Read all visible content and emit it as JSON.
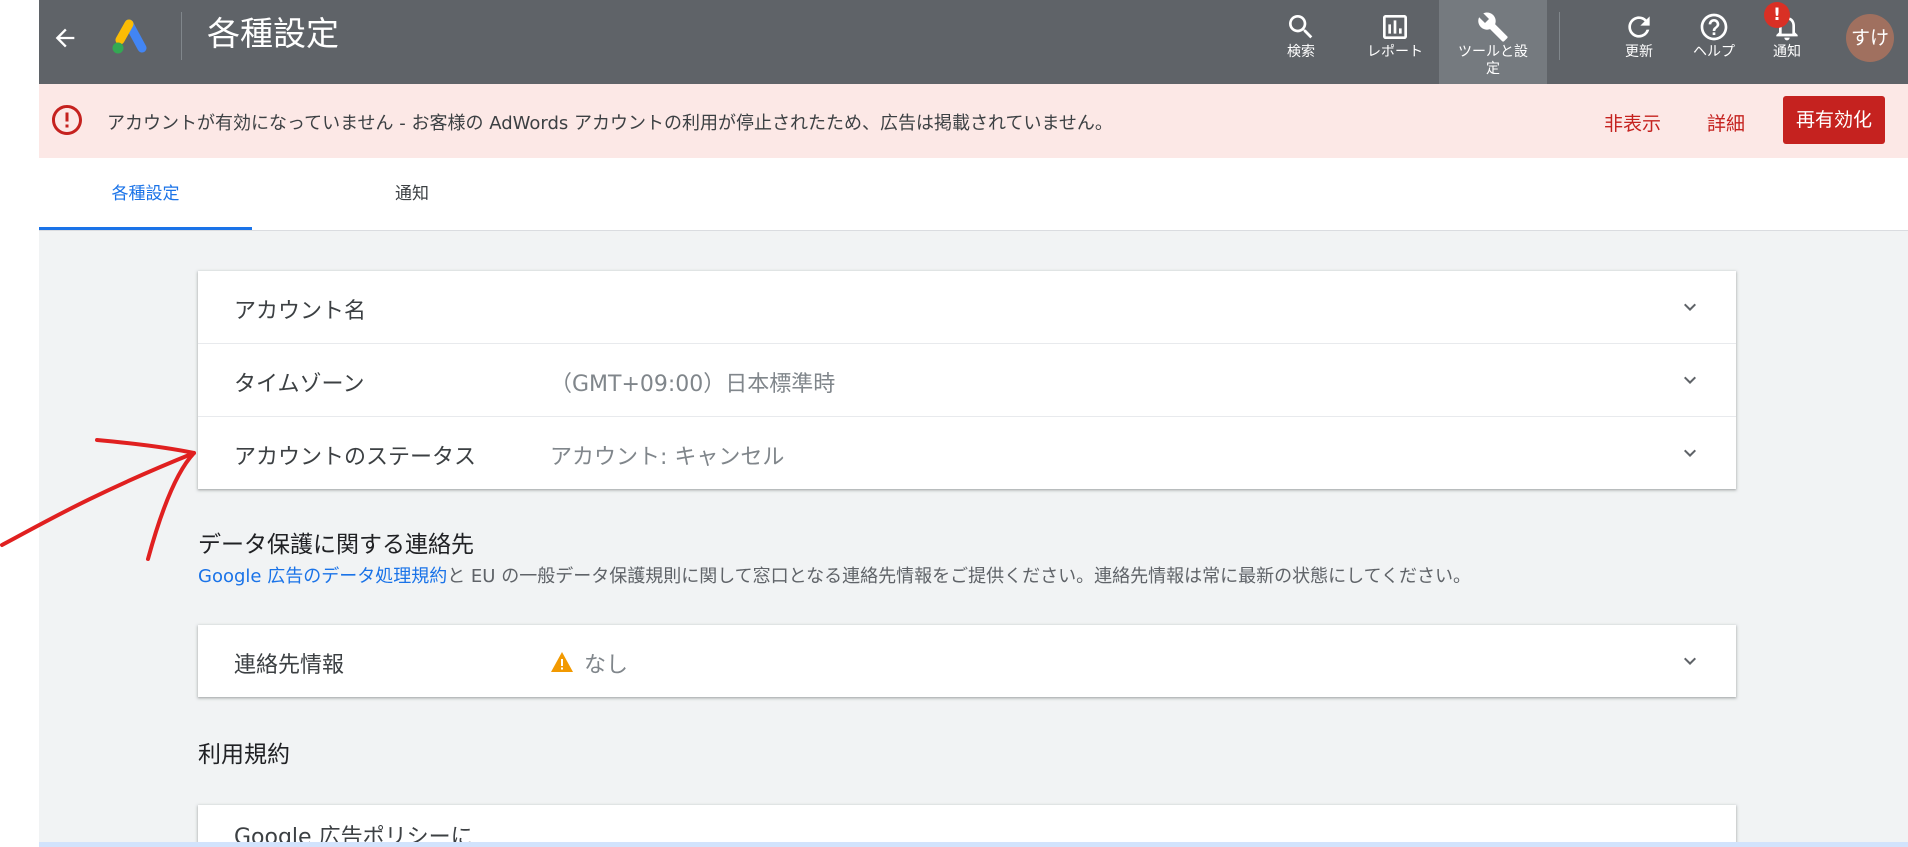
{
  "header": {
    "title": "各種設定",
    "tools": [
      {
        "label": "検索",
        "icon": "search-icon"
      },
      {
        "label": "レポート",
        "icon": "bar-chart-icon"
      },
      {
        "label": "ツールと設定",
        "icon": "wrench-icon"
      },
      {
        "label": "更新",
        "icon": "refresh-icon"
      },
      {
        "label": "ヘルプ",
        "icon": "help-icon"
      },
      {
        "label": "通知",
        "icon": "bell-icon"
      }
    ],
    "notification_badge": "!",
    "avatar_text": "すけ"
  },
  "alert": {
    "message": "アカウントが有効になっていません - お客様の AdWords アカウントの利用が停止されたため、広告は掲載されていません。",
    "hide_label": "非表示",
    "details_label": "詳細",
    "reactivate_label": "再有効化"
  },
  "tabs": [
    {
      "label": "各種設定",
      "active": true
    },
    {
      "label": "通知",
      "active": false
    }
  ],
  "settings": [
    {
      "label": "アカウント名",
      "value": ""
    },
    {
      "label": "タイムゾーン",
      "value": "（GMT+09:00）日本標準時"
    },
    {
      "label": "アカウントのステータス",
      "value": "アカウント: キャンセル"
    }
  ],
  "data_protection": {
    "title": "データ保護に関する連絡先",
    "link_text": "Google 広告のデータ処理規約",
    "description": "と EU の一般データ保護規則に関して窓口となる連絡先情報をご提供ください。連絡先情報は常に最新の状態にしてください。",
    "contact_label": "連絡先情報",
    "contact_value": "なし"
  },
  "terms": {
    "title": "利用規約",
    "row_label": "Google 広告ポリシーに"
  },
  "colors": {
    "topbar": "#5f6368",
    "alert_bg": "#fce8e6",
    "alert_red": "#c5221f",
    "accent": "#1a73e8",
    "annotation": "#e02020"
  }
}
